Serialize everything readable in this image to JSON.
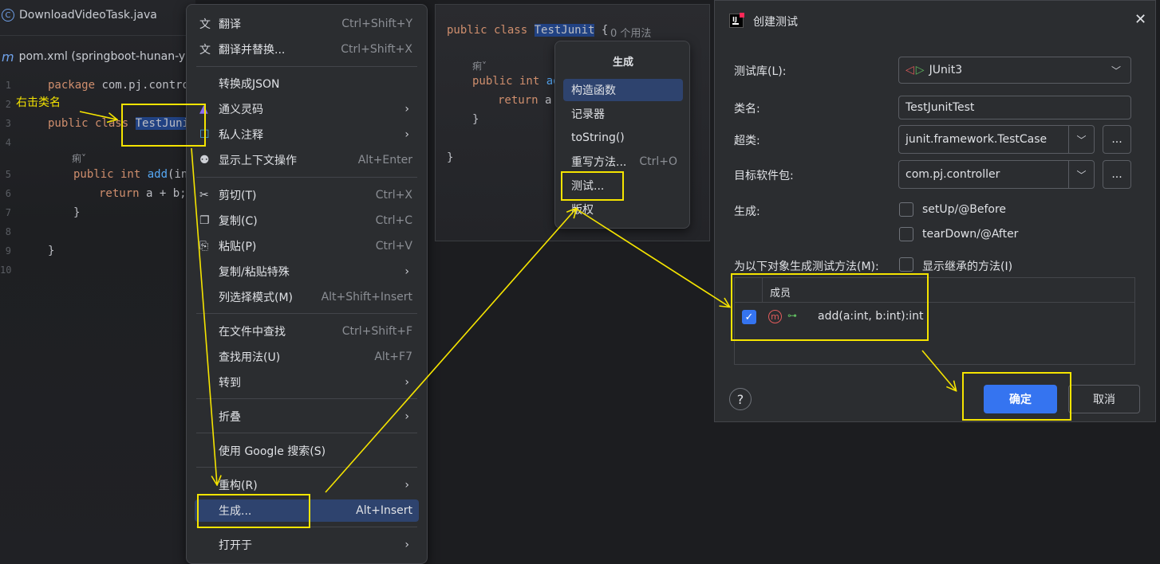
{
  "editor_left": {
    "tabs": [
      {
        "icon": "java-class-icon",
        "icon_glyph": "C",
        "label": "DownloadVideoTask.java"
      },
      {
        "icon": "maven-icon",
        "icon_glyph": "m",
        "label": "pom.xml (springboot-hunan-yit"
      }
    ],
    "lines": [
      "1",
      "2",
      "3",
      "4",
      "5",
      "6",
      "7",
      "8",
      "9",
      "10"
    ],
    "code": {
      "package_kw": "package",
      "package_rest": " com.pj.controlle",
      "public_kw": "public class",
      "class_name": "TestJunit",
      "ai_hint": "痢˅",
      "method_kw": "public int",
      "method_name": "add",
      "method_rest": "(int",
      "return_kw": "return",
      "return_rest": " a + b;",
      "close_brace_inner": "}",
      "close_brace_outer": "}"
    },
    "annotation": "右击类名"
  },
  "context_menu": {
    "items": [
      {
        "icon": "translate-icon",
        "glyph": "文",
        "label": "翻译",
        "shortcut": "Ctrl+Shift+Y",
        "submenu": false
      },
      {
        "icon": "translate-replace-icon",
        "glyph": "文",
        "label": "翻译并替换...",
        "shortcut": "Ctrl+Shift+X",
        "submenu": false
      },
      {
        "icon": "",
        "glyph": "",
        "label": "转换成JSON",
        "shortcut": "",
        "submenu": false
      },
      {
        "icon": "tongyi-icon",
        "glyph": "▲",
        "label": "通义灵码",
        "shortcut": "",
        "submenu": true
      },
      {
        "icon": "private-note-icon",
        "glyph": "☐",
        "label": "私人注释",
        "shortcut": "",
        "submenu": true
      },
      {
        "icon": "bulb-icon",
        "glyph": "⚉",
        "label": "显示上下文操作",
        "shortcut": "Alt+Enter",
        "submenu": false
      },
      {
        "icon": "cut-icon",
        "glyph": "✂",
        "label": "剪切(T)",
        "shortcut": "Ctrl+X",
        "submenu": false
      },
      {
        "icon": "copy-icon",
        "glyph": "❐",
        "label": "复制(C)",
        "shortcut": "Ctrl+C",
        "submenu": false
      },
      {
        "icon": "paste-icon",
        "glyph": "⎘",
        "label": "粘贴(P)",
        "shortcut": "Ctrl+V",
        "submenu": false
      },
      {
        "icon": "",
        "glyph": "",
        "label": "复制/粘贴特殊",
        "shortcut": "",
        "submenu": true
      },
      {
        "icon": "",
        "glyph": "",
        "label": "列选择模式(M)",
        "shortcut": "Alt+Shift+Insert",
        "submenu": false
      },
      {
        "icon": "",
        "glyph": "",
        "label": "在文件中查找",
        "shortcut": "Ctrl+Shift+F",
        "submenu": false
      },
      {
        "icon": "",
        "glyph": "",
        "label": "查找用法(U)",
        "shortcut": "Alt+F7",
        "submenu": false
      },
      {
        "icon": "",
        "glyph": "",
        "label": "转到",
        "shortcut": "",
        "submenu": true
      },
      {
        "icon": "",
        "glyph": "",
        "label": "折叠",
        "shortcut": "",
        "submenu": true
      },
      {
        "icon": "",
        "glyph": "",
        "label": "使用 Google 搜索(S)",
        "shortcut": "",
        "submenu": false
      },
      {
        "icon": "",
        "glyph": "",
        "label": "重构(R)",
        "shortcut": "",
        "submenu": true
      },
      {
        "icon": "",
        "glyph": "",
        "label": "生成...",
        "shortcut": "Alt+Insert",
        "submenu": false,
        "selected": true
      },
      {
        "icon": "",
        "glyph": "",
        "label": "打开于",
        "shortcut": "",
        "submenu": true
      }
    ]
  },
  "editor_mid": {
    "public_kw": "public class",
    "class_name": "TestJunit",
    "brace": "{",
    "usages": "0 个用法",
    "ai_hint": "痢˅",
    "method_kw": "public int",
    "method_name": "ad",
    "return_kw": "return",
    "return_rest": " a",
    "close_inner": "}",
    "close_outer": "}"
  },
  "generate_popup": {
    "title": "生成",
    "items": [
      {
        "label": "构造函数",
        "shortcut": "",
        "selected": true
      },
      {
        "label": "记录器",
        "shortcut": ""
      },
      {
        "label": "toString()",
        "shortcut": ""
      },
      {
        "label": "重写方法...",
        "shortcut": "Ctrl+O"
      },
      {
        "label": "测试...",
        "shortcut": ""
      },
      {
        "label": "版权",
        "shortcut": ""
      }
    ]
  },
  "dialog": {
    "title": "创建测试",
    "labels": {
      "library": "测试库(L):",
      "class_name": "类名:",
      "superclass": "超类:",
      "package": "目标软件包:",
      "generate": "生成:",
      "methods_for": "为以下对象生成测试方法(M):"
    },
    "library_value": "JUnit3",
    "class_name_value": "TestJunitTest",
    "superclass_value": "junit.framework.TestCase",
    "package_value": "com.pj.controller",
    "dots_label": "...",
    "setup_label": "setUp/@Before",
    "teardown_label": "tearDown/@After",
    "show_inherited_label": "显示继承的方法(I)",
    "table_header": "成员",
    "member": {
      "checked": true,
      "label": "add(a:int, b:int):int"
    },
    "ok_label": "确定",
    "cancel_label": "取消",
    "help_label": "?",
    "colors": {
      "accent": "#3574f0",
      "annotation": "#f5e400"
    }
  }
}
